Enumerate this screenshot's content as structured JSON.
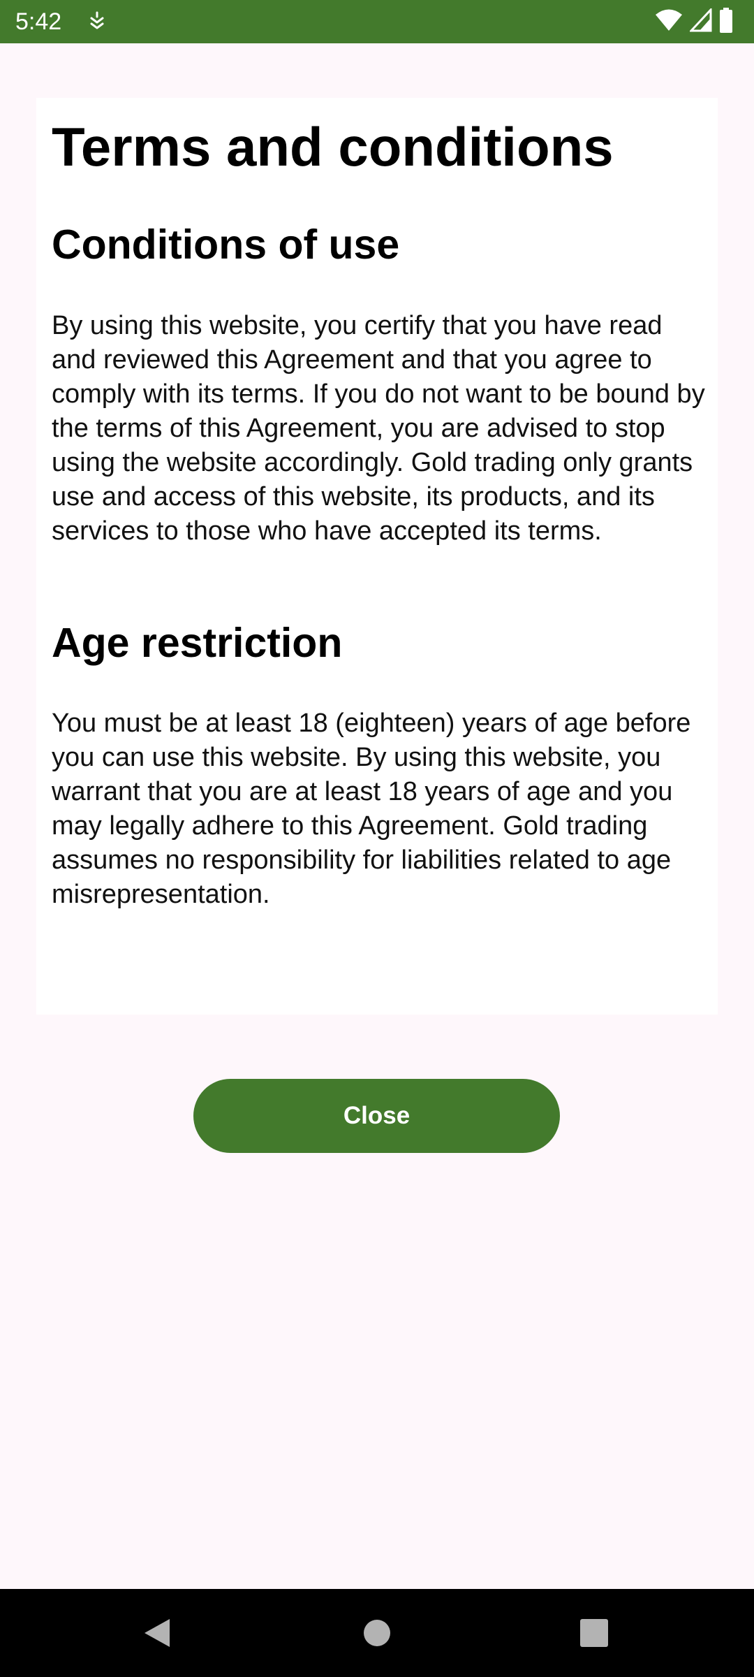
{
  "status_bar": {
    "time": "5:42",
    "color": "#437a2c",
    "icons": [
      "notification-icon",
      "wifi-icon",
      "signal-icon",
      "battery-icon"
    ]
  },
  "page": {
    "title": "Terms and conditions",
    "sections": [
      {
        "heading": "Conditions of use",
        "body": "By using this website, you certify that you have read and reviewed this Agreement and that you agree to comply with its terms. If you do not want to be bound by the terms of this Agreement, you are advised to stop using the website accordingly. Gold trading only grants use and access of this website, its products, and its services to those who have accepted its terms."
      },
      {
        "heading": "Age restriction",
        "body": "You must be at least 18 (eighteen) years of age before you can use this website. By using this website, you warrant that you are at least 18 years of age and you may legally adhere to this Agreement. Gold trading assumes no responsibility for liabilities related to age misrepresentation."
      }
    ]
  },
  "actions": {
    "close_label": "Close"
  },
  "nav_bar": {
    "icons": [
      "back-icon",
      "home-icon",
      "recents-icon"
    ]
  },
  "colors": {
    "accent": "#437a2c",
    "background": "#fef7fb",
    "card": "#ffffff"
  }
}
